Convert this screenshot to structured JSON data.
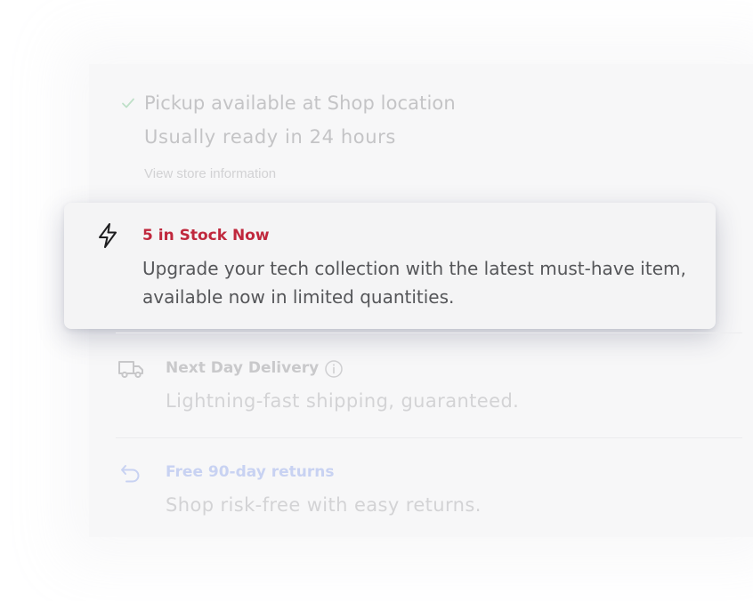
{
  "pickup": {
    "title": "Pickup available at Shop location",
    "subtitle": "Usually ready in 24 hours",
    "link": "View store information"
  },
  "stock": {
    "title": "5 in Stock Now",
    "description": "Upgrade your tech collection with the latest must-have item, available now in limited quantities."
  },
  "delivery": {
    "title": "Next Day Delivery",
    "subtitle": "Lightning-fast shipping, guaranteed."
  },
  "returns": {
    "title": "Free 90-day returns",
    "subtitle": "Shop risk-free with easy returns."
  },
  "colors": {
    "accent_red": "#c0283d",
    "returns_blue": "#c8d2f2",
    "check_green": "#bfe0c8"
  },
  "icons": [
    "check-icon",
    "lightning-bolt-icon",
    "truck-icon",
    "info-icon",
    "return-arrow-icon"
  ]
}
